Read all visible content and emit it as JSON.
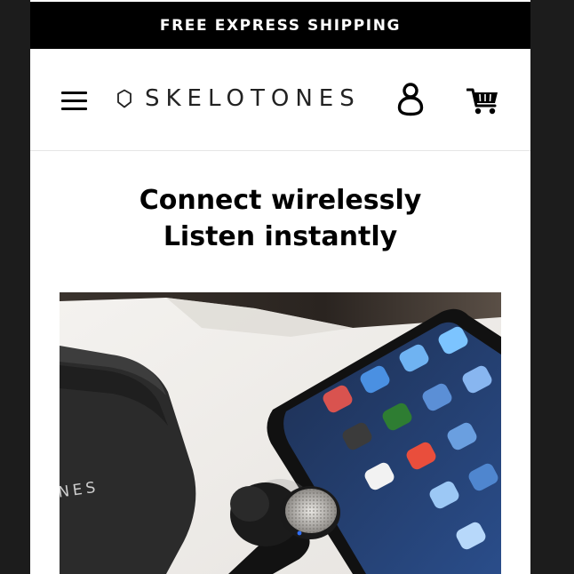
{
  "promo": {
    "text": "FREE EXPRESS SHIPPING"
  },
  "header": {
    "menu_icon": "hamburger-menu-icon",
    "logo_text": "SKELOTONES",
    "logo_icon": "hexagon-shield-icon",
    "account_icon": "user-account-icon",
    "cart_icon": "shopping-cart-icon"
  },
  "hero": {
    "line1": "Connect wirelessly",
    "line2": "Listen instantly",
    "case_print": "NES"
  },
  "colors": {
    "promo_bg": "#000000",
    "promo_text": "#ffffff",
    "page_bg": "#ffffff",
    "outer_bg": "#1c1c1c",
    "text": "#000000"
  }
}
